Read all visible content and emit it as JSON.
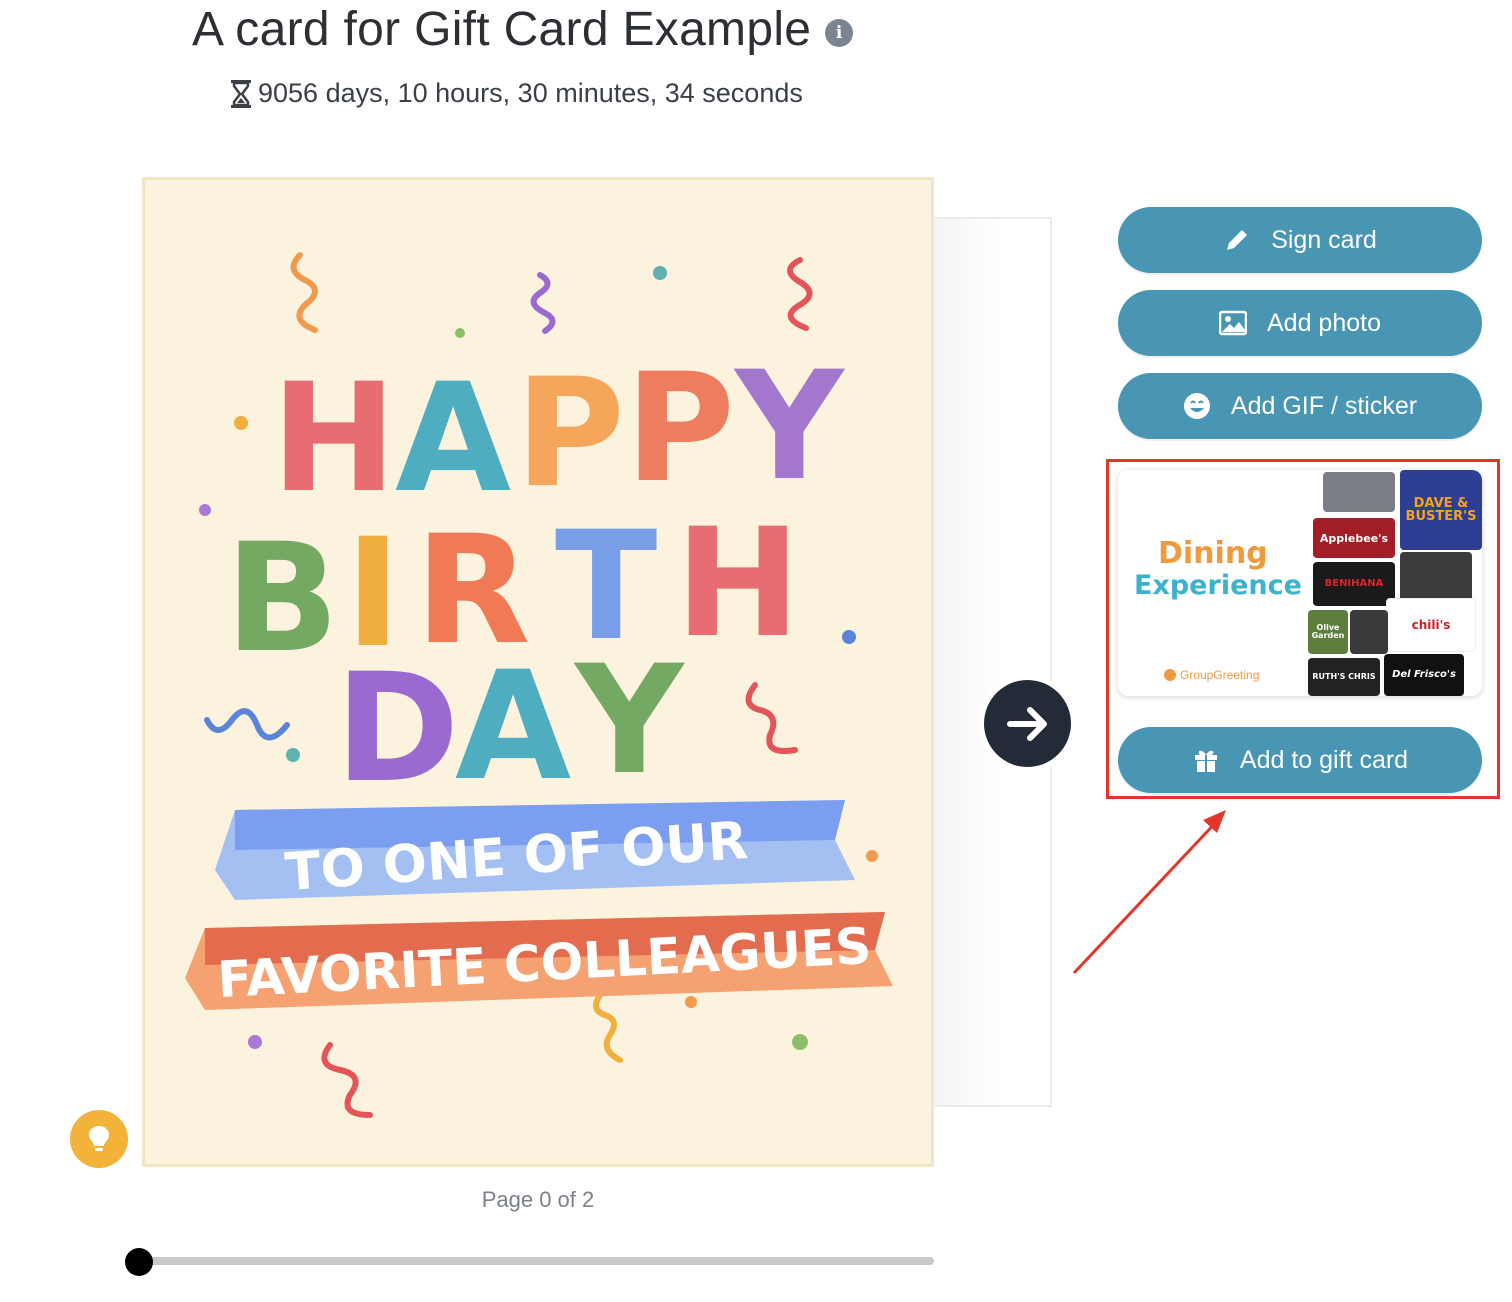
{
  "header": {
    "title": "A card for Gift Card Example",
    "countdown": "9056 days, 10 hours, 30 minutes, 34 seconds"
  },
  "card": {
    "line1": "HAPPY",
    "line2": "BIRTH",
    "line3": "DAY",
    "ribbon1": "TO ONE OF OUR",
    "ribbon2": "FAVORITE COLLEAGUES"
  },
  "pagination": {
    "label": "Page 0 of 2",
    "current": 0,
    "total": 2
  },
  "actions": {
    "sign": "Sign card",
    "photo": "Add photo",
    "gif": "Add GIF / sticker",
    "gift": "Add to gift card"
  },
  "gift_preview": {
    "title_line1": "Dining",
    "title_line2": "Experience",
    "brand": "GroupGreeting",
    "cards": {
      "dave": "DAVE & BUSTER'S",
      "applebees": "Applebee's",
      "benihana": "BENIHANA",
      "chilis": "chili's",
      "olive": "Olive Garden",
      "ruths": "RUTH'S CHRIS",
      "delfriscos": "Del Frisco's"
    }
  },
  "colors": {
    "button": "#4895b4",
    "highlight": "#e2362b",
    "next_button": "#232b38",
    "idea_button": "#f3b23a"
  }
}
